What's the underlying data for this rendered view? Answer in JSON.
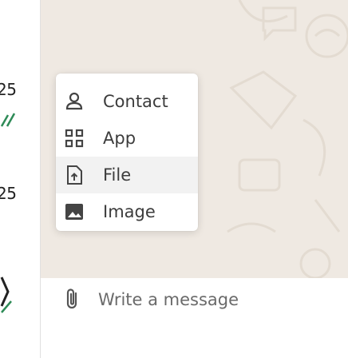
{
  "left_panel": {
    "items": [
      {
        "time": "25"
      },
      {
        "time": "25"
      }
    ]
  },
  "attach_menu": {
    "items": [
      {
        "label": "Contact",
        "icon": "person-icon"
      },
      {
        "label": "App",
        "icon": "apps-grid-icon"
      },
      {
        "label": "File",
        "icon": "file-upload-icon"
      },
      {
        "label": "Image",
        "icon": "image-icon"
      }
    ],
    "hovered_index": 2
  },
  "composer": {
    "placeholder": "Write a message",
    "value": ""
  },
  "colors": {
    "wallpaper": "#efe9e2",
    "menu_bg": "#ffffff",
    "hover_bg": "#f2f2f2",
    "text": "#3c3c3c",
    "read_check": "#2e8b57"
  }
}
